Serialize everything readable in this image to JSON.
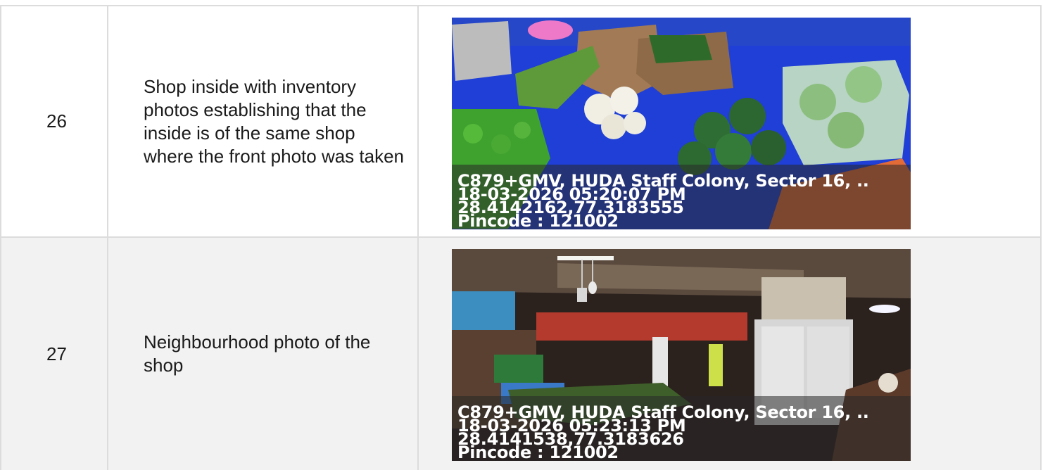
{
  "rows": [
    {
      "number": "26",
      "description": "Shop inside with inventory photos establishing that the inside is of the same shop where the front photo was taken",
      "photo": {
        "subject": "vegetable stall interior with inventory",
        "address_line": "C879+GMV, HUDA Staff Colony, Sector 16, ..",
        "datetime": "18-03-2026 05:20:07 PM",
        "coordinates": "28.4142162,77.3183555",
        "pincode": "Pincode : 121002"
      }
    },
    {
      "number": "27",
      "description": "Neighbourhood photo of the shop",
      "photo": {
        "subject": "covered market neighbourhood view",
        "address_line": "C879+GMV, HUDA Staff Colony, Sector 16, ..",
        "datetime": "18-03-2026 05:23:13 PM",
        "coordinates": "28.4141538,77.3183626",
        "pincode": "Pincode : 121002"
      }
    }
  ]
}
